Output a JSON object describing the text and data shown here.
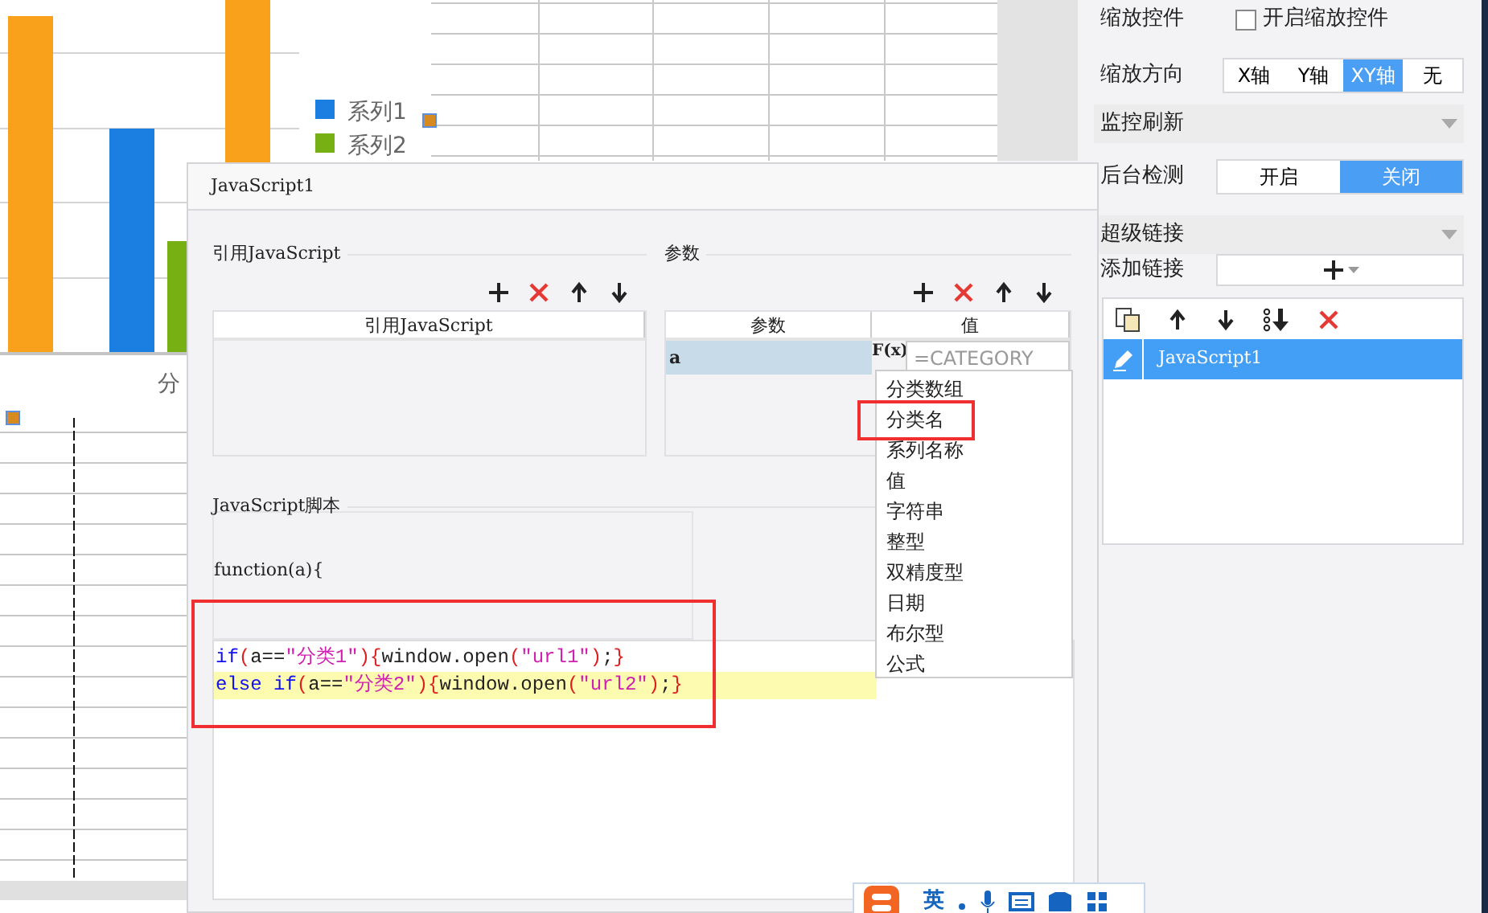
{
  "report_canvas": {
    "legend": [
      {
        "label": "系列1",
        "color": "#1a7fe0"
      },
      {
        "label": "系列2",
        "color": "#76b013"
      }
    ],
    "axis_label": "分"
  },
  "properties_panel": {
    "zoom_control": {
      "label": "缩放控件",
      "checkbox_label": "开启缩放控件",
      "checked": false
    },
    "zoom_direction": {
      "label": "缩放方向",
      "options": [
        {
          "label": "X轴",
          "selected": false
        },
        {
          "label": "Y轴",
          "selected": false
        },
        {
          "label": "XY轴",
          "selected": true
        },
        {
          "label": "无",
          "selected": false
        }
      ]
    },
    "monitor_section": {
      "title": "监控刷新"
    },
    "background_check": {
      "label": "后台检测",
      "options": [
        {
          "label": "开启",
          "selected": false
        },
        {
          "label": "关闭",
          "selected": true
        }
      ]
    },
    "hyperlink_section": {
      "title": "超级链接"
    },
    "add_link": {
      "label": "添加链接"
    },
    "links": [
      {
        "name": "JavaScript1",
        "selected": true
      }
    ]
  },
  "dialog": {
    "title": "JavaScript1",
    "imports": {
      "title": "引用JavaScript",
      "column": "引用JavaScript"
    },
    "params": {
      "title": "参数",
      "columns": [
        "参数",
        "值"
      ],
      "fx_label": "F(x)",
      "rows": [
        {
          "name": "a",
          "value": "=CATEGORY",
          "selected": true
        }
      ]
    },
    "value_menu": [
      {
        "label": "分类数组",
        "highlighted": false
      },
      {
        "label": "分类名",
        "highlighted": true
      },
      {
        "label": "系列名称",
        "highlighted": false
      },
      {
        "label": "值",
        "highlighted": false
      },
      {
        "label": "字符串",
        "highlighted": false
      },
      {
        "label": "整型",
        "highlighted": false
      },
      {
        "label": "双精度型",
        "highlighted": false
      },
      {
        "label": "日期",
        "highlighted": false
      },
      {
        "label": "布尔型",
        "highlighted": false
      },
      {
        "label": "公式",
        "highlighted": false
      }
    ],
    "script": {
      "title": "JavaScript脚本",
      "header": "function(a){",
      "lines": [
        {
          "current": false,
          "tokens": [
            {
              "kind": "keyword",
              "text": "if"
            },
            {
              "kind": "bracket",
              "text": "("
            },
            {
              "kind": "plain",
              "text": "a=="
            },
            {
              "kind": "string",
              "text": "\"分类1\""
            },
            {
              "kind": "bracket",
              "text": ")"
            },
            {
              "kind": "bracket",
              "text": "{"
            },
            {
              "kind": "plain",
              "text": "window.open"
            },
            {
              "kind": "bracket",
              "text": "("
            },
            {
              "kind": "string",
              "text": "\"url1\""
            },
            {
              "kind": "bracket",
              "text": ")"
            },
            {
              "kind": "plain",
              "text": ";"
            },
            {
              "kind": "bracket",
              "text": "}"
            }
          ]
        },
        {
          "current": true,
          "tokens": [
            {
              "kind": "keyword",
              "text": "else if"
            },
            {
              "kind": "bracket",
              "text": "("
            },
            {
              "kind": "plain",
              "text": "a=="
            },
            {
              "kind": "string",
              "text": "\"分类2\""
            },
            {
              "kind": "bracket",
              "text": ")"
            },
            {
              "kind": "bracket",
              "text": "{"
            },
            {
              "kind": "plain",
              "text": "window.open"
            },
            {
              "kind": "bracket",
              "text": "("
            },
            {
              "kind": "string",
              "text": "\"url2\""
            },
            {
              "kind": "bracket",
              "text": ")"
            },
            {
              "kind": "plain",
              "text": ";"
            },
            {
              "kind": "bracket",
              "text": "}"
            }
          ]
        }
      ]
    }
  },
  "ime_bar": {
    "mode": "英"
  }
}
